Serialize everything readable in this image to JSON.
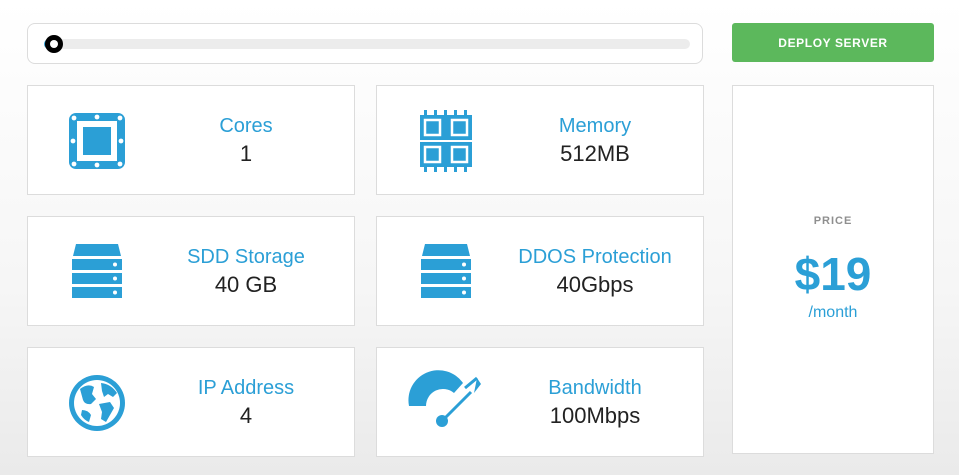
{
  "slider": {
    "progress": 0.015,
    "fill_color": "#2b9fd6",
    "handle_color": "#000000"
  },
  "deploy": {
    "label": "DEPLOY SERVER",
    "color": "#5cb85c"
  },
  "specs": [
    {
      "label": "Cores",
      "value": "1",
      "icon": "cpu-icon"
    },
    {
      "label": "Memory",
      "value": "512MB",
      "icon": "memory-icon"
    },
    {
      "label": "SDD Storage",
      "value": "40 GB",
      "icon": "server-icon"
    },
    {
      "label": "DDOS Protection",
      "value": "40Gbps",
      "icon": "server-icon"
    },
    {
      "label": "IP Address",
      "value": "4",
      "icon": "globe-icon"
    },
    {
      "label": "Bandwidth",
      "value": "100Mbps",
      "icon": "speedometer-icon"
    }
  ],
  "price": {
    "label": "PRICE",
    "amount": "$19",
    "period": "/month"
  },
  "colors": {
    "accent": "#2b9fd6",
    "success": "#5cb85c",
    "text": "#222222",
    "muted": "#8f8f8f"
  }
}
